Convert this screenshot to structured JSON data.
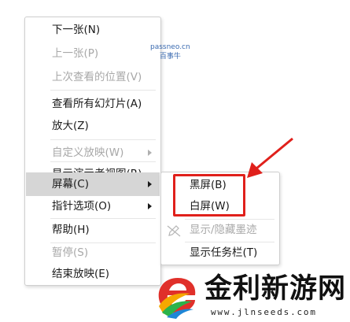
{
  "context_menu": {
    "items": [
      {
        "label": "下一张(N)",
        "enabled": true
      },
      {
        "label": "上一张(P)",
        "enabled": false
      },
      {
        "label": "上次查看的位置(V)",
        "enabled": false
      },
      {
        "label": "查看所有幻灯片(A)",
        "enabled": true
      },
      {
        "label": "放大(Z)",
        "enabled": true
      },
      {
        "label": "自定义放映(W)",
        "enabled": false,
        "has_submenu": true
      },
      {
        "label": "显示演示者视图(R)",
        "enabled": true
      },
      {
        "label": "屏幕(C)",
        "enabled": true,
        "has_submenu": true,
        "highlighted": true
      },
      {
        "label": "指针选项(O)",
        "enabled": true,
        "has_submenu": true
      },
      {
        "label": "帮助(H)",
        "enabled": true
      },
      {
        "label": "暂停(S)",
        "enabled": false
      },
      {
        "label": "结束放映(E)",
        "enabled": true
      }
    ]
  },
  "screen_submenu": {
    "items": [
      {
        "label": "黑屏(B)",
        "enabled": true
      },
      {
        "label": "白屏(W)",
        "enabled": true
      },
      {
        "label": "显示/隐藏墨迹",
        "enabled": false,
        "icon": "pen-slash-icon"
      },
      {
        "label": "显示任务栏(T)",
        "enabled": true
      }
    ]
  },
  "watermark": {
    "line1": "passneo.cn",
    "line2": "百事牛"
  },
  "logo": {
    "name": "金利新游网",
    "url": "www.jlnseeds.com"
  },
  "colors": {
    "annotation_red": "#e0201b",
    "hover_gray": "#d6d6d6",
    "disabled_text": "#a8a8a8"
  }
}
